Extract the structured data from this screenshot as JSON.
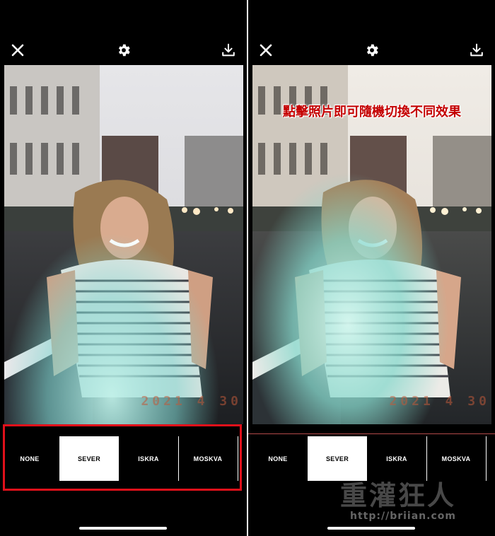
{
  "left": {
    "icons": {
      "close": "close-icon",
      "settings": "gear-icon",
      "download": "download-icon"
    },
    "date_stamp": "2021  4  30",
    "filters": [
      {
        "label": "NONE",
        "active": false
      },
      {
        "label": "SEVER",
        "active": true
      },
      {
        "label": "ISKRA",
        "active": false
      },
      {
        "label": "MOSKVA",
        "active": false
      }
    ],
    "highlight_color": "#e0101a"
  },
  "right": {
    "icons": {
      "close": "close-icon",
      "settings": "gear-icon",
      "download": "download-icon"
    },
    "caption": "點擊照片即可隨機切換不同效果",
    "date_stamp": "2021  4  30",
    "filters": [
      {
        "label": "NONE",
        "active": false
      },
      {
        "label": "SEVER",
        "active": true
      },
      {
        "label": "ISKRA",
        "active": false
      },
      {
        "label": "MOSKVA",
        "active": false
      }
    ],
    "watermark": {
      "title": "重灌狂人",
      "url": "http://briian.com"
    }
  },
  "colors": {
    "background": "#000000",
    "foreground": "#ffffff",
    "caption": "#c40000"
  }
}
